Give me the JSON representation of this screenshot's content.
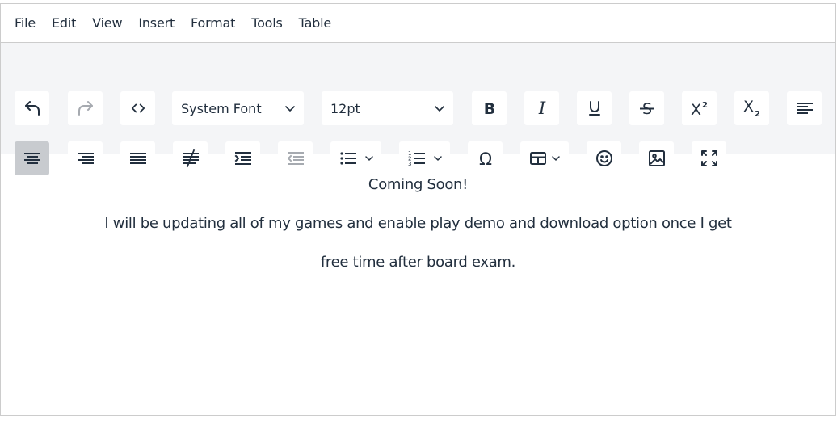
{
  "menubar": {
    "items": [
      "File",
      "Edit",
      "View",
      "Insert",
      "Format",
      "Tools",
      "Table"
    ]
  },
  "toolbar": {
    "font_family": "System Font",
    "font_size": "12pt",
    "icons": {
      "undo": "undo-icon",
      "redo": "redo-icon",
      "code": "code-icon",
      "bold": "bold-icon",
      "italic": "italic-icon",
      "underline": "underline-icon",
      "strikethrough": "strikethrough-icon",
      "superscript": "superscript-icon",
      "subscript": "subscript-icon",
      "align_left": "align-left-icon",
      "align_center": "align-center-icon",
      "align_right": "align-right-icon",
      "align_justify": "align-justify-icon",
      "remove_format": "remove-format-icon",
      "indent": "indent-icon",
      "outdent": "outdent-icon",
      "bullet_list": "bullet-list-icon",
      "numbered_list": "numbered-list-icon",
      "special_char": "omega-icon",
      "table": "table-icon",
      "emoticons": "emoji-icon",
      "image": "image-icon",
      "fullscreen": "fullscreen-icon"
    },
    "active": "align_center"
  },
  "content": {
    "lines": [
      "Coming Soon!",
      "I will be updating all of my games and enable play demo and download option once I get",
      "free time after board exam."
    ]
  },
  "colors": {
    "toolbar_bg": "#f4f5f7",
    "active_button": "#c8cbcf",
    "text": "#222f3e"
  }
}
